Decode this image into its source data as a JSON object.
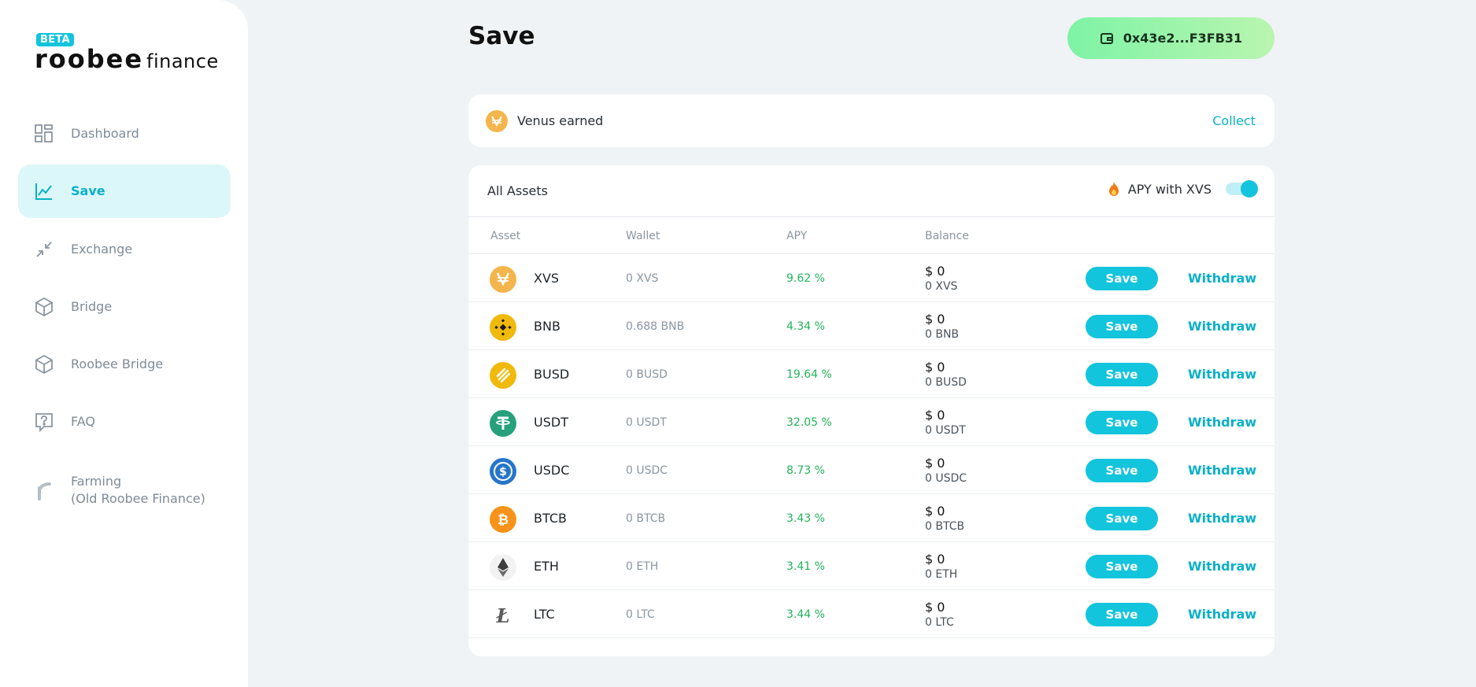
{
  "brand": {
    "beta": "BETA",
    "name": "roobee",
    "suffix": "finance"
  },
  "nav": [
    {
      "label": "Dashboard",
      "icon": "dashboard-icon"
    },
    {
      "label": "Save",
      "icon": "chart-line-icon",
      "active": true
    },
    {
      "label": "Exchange",
      "icon": "exchange-arrows-icon"
    },
    {
      "label": "Bridge",
      "icon": "cube-icon"
    },
    {
      "label": "Roobee Bridge",
      "icon": "cube-icon"
    },
    {
      "label": "FAQ",
      "icon": "faq-icon"
    },
    {
      "label": "Farming",
      "sub": "(Old Roobee Finance)",
      "icon": "roobee-r-icon"
    }
  ],
  "header": {
    "title": "Save",
    "wallet": "0x43e2...F3FB31"
  },
  "venus": {
    "label": "Venus earned",
    "action": "Collect"
  },
  "assets": {
    "title": "All Assets",
    "apy_toggle_label": "APY with XVS",
    "apy_toggle_on": true,
    "columns": {
      "asset": "Asset",
      "wallet": "Wallet",
      "apy": "APY",
      "balance": "Balance"
    },
    "save_label": "Save",
    "withdraw_label": "Withdraw",
    "rows": [
      {
        "symbol": "XVS",
        "wallet": "0 XVS",
        "apy": "9.62 %",
        "usd": "$ 0",
        "amount": "0 XVS",
        "color": "#f3b54c"
      },
      {
        "symbol": "BNB",
        "wallet": "0.688 BNB",
        "apy": "4.34 %",
        "usd": "$ 0",
        "amount": "0 BNB",
        "color": "#f0b90b"
      },
      {
        "symbol": "BUSD",
        "wallet": "0 BUSD",
        "apy": "19.64 %",
        "usd": "$ 0",
        "amount": "0 BUSD",
        "color": "#f0b90b"
      },
      {
        "symbol": "USDT",
        "wallet": "0 USDT",
        "apy": "32.05 %",
        "usd": "$ 0",
        "amount": "0 USDT",
        "color": "#26a17b"
      },
      {
        "symbol": "USDC",
        "wallet": "0 USDC",
        "apy": "8.73 %",
        "usd": "$ 0",
        "amount": "0 USDC",
        "color": "#2775ca"
      },
      {
        "symbol": "BTCB",
        "wallet": "0 BTCB",
        "apy": "3.43 %",
        "usd": "$ 0",
        "amount": "0 BTCB",
        "color": "#f7931a"
      },
      {
        "symbol": "ETH",
        "wallet": "0 ETH",
        "apy": "3.41 %",
        "usd": "$ 0",
        "amount": "0 ETH",
        "color": "#3c3c3d"
      },
      {
        "symbol": "LTC",
        "wallet": "0 LTC",
        "apy": "3.44 %",
        "usd": "$ 0",
        "amount": "0 LTC",
        "color": "#5c5c5c"
      }
    ]
  },
  "colors": {
    "accent": "#12c4dc",
    "apy_green": "#21b35a",
    "wallet_green": "#7ef3a5"
  }
}
